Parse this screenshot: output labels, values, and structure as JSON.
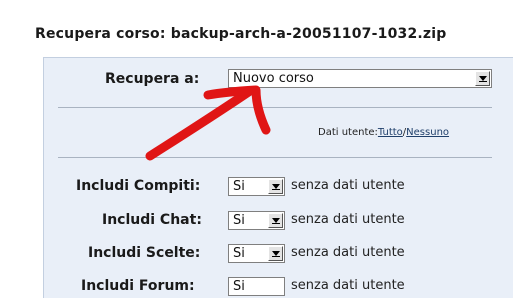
{
  "title": "Recupera corso: backup-arch-a-20051107-1032.zip",
  "restore_to": {
    "label": "Recupera a:",
    "value": "Nuovo corso"
  },
  "user_data": {
    "label": "Dati utente:",
    "all": "Tutto",
    "separator": "/",
    "none": "Nessuno"
  },
  "includes": [
    {
      "label": "Includi Compiti:",
      "value": "Si",
      "note": "senza dati utente"
    },
    {
      "label": "Includi Chat:",
      "value": "Si",
      "note": "senza dati utente"
    },
    {
      "label": "Includi Scelte:",
      "value": "Si",
      "note": "senza dati utente"
    },
    {
      "label": "Includi Forum:",
      "value": "Si",
      "note": "senza dati utente"
    }
  ],
  "colors": {
    "panel_bg": "#e9eff8",
    "annotation_arrow": "#e01515",
    "link": "#1f3f6a"
  }
}
